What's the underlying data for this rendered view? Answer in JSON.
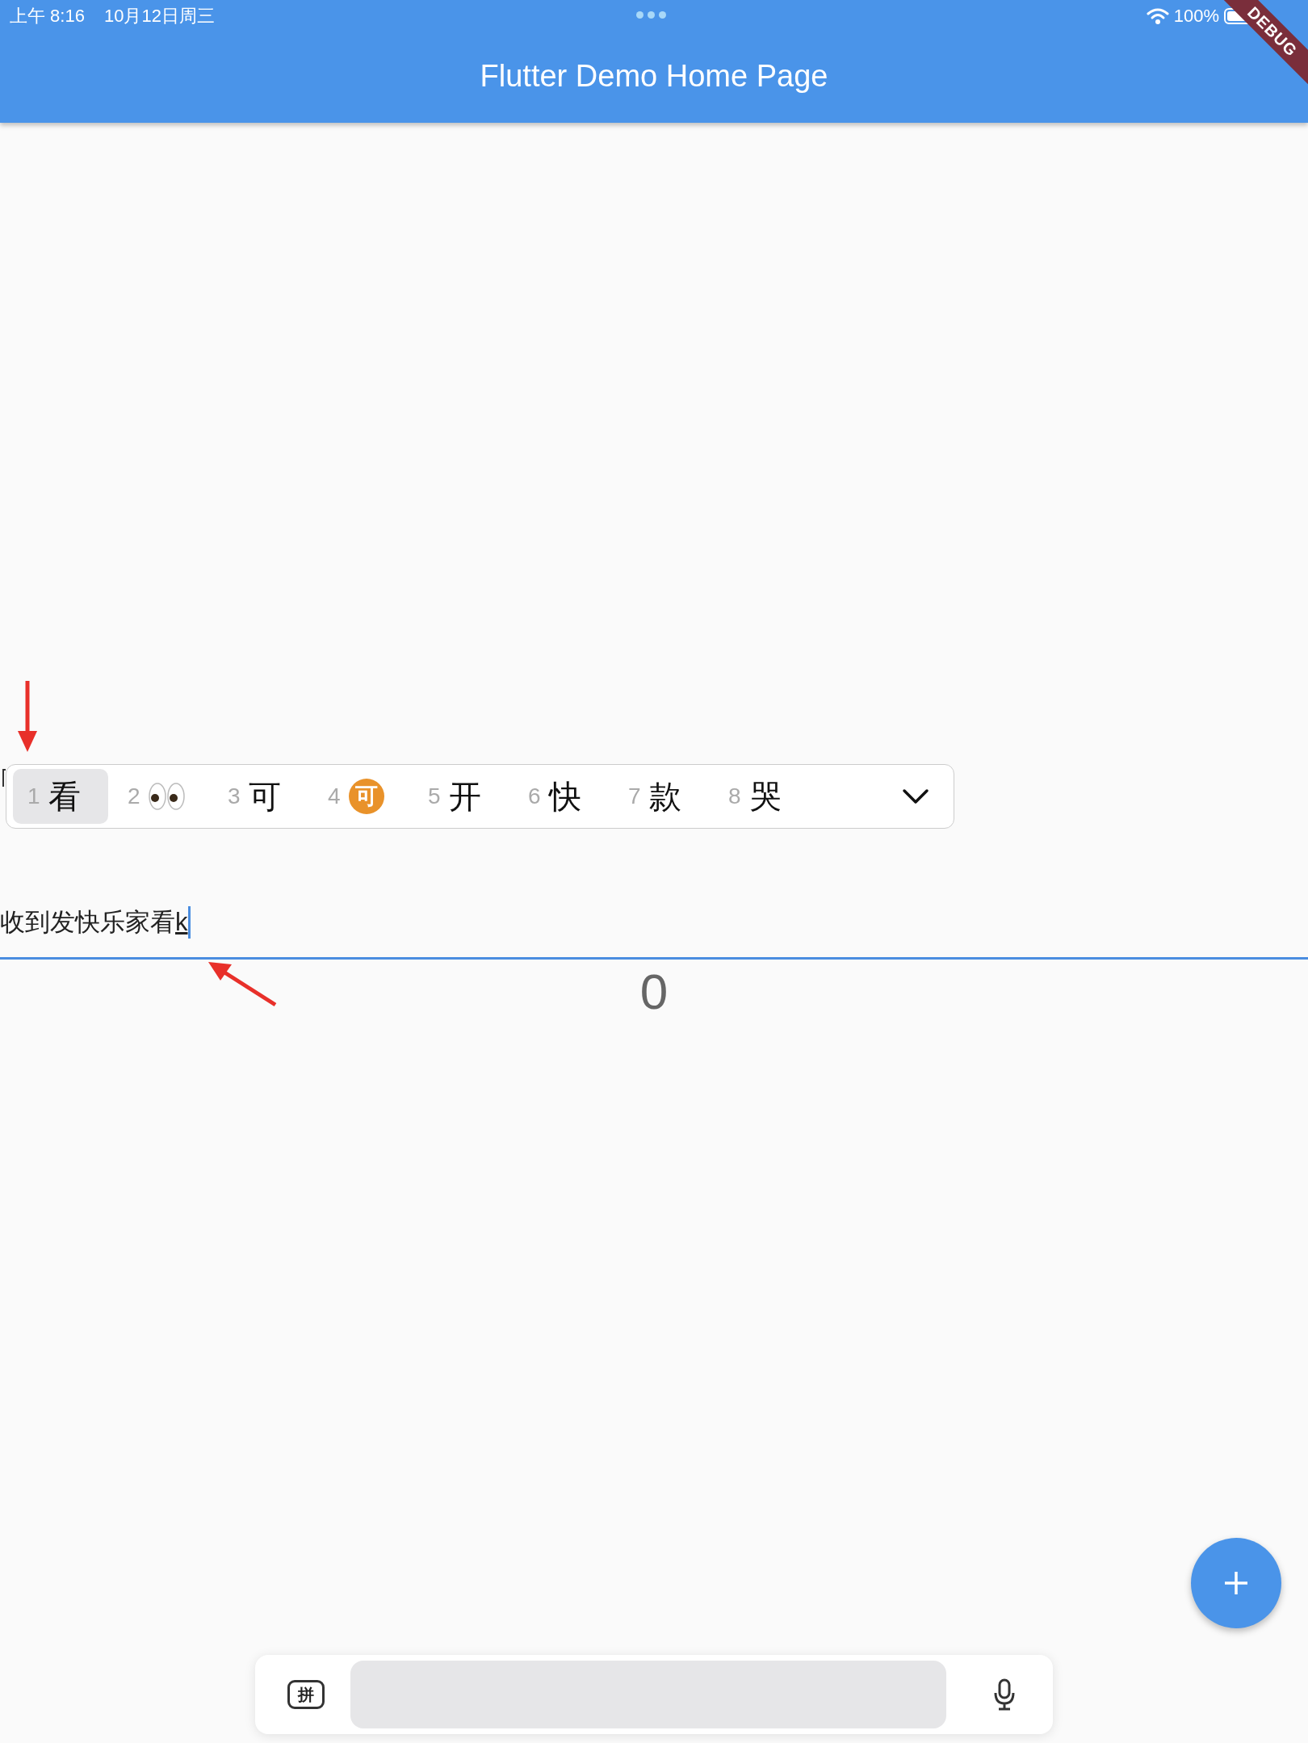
{
  "status_bar": {
    "time": "上午 8:16",
    "date": "10月12日周三",
    "battery": "100%"
  },
  "app_bar": {
    "title": "Flutter Demo Home Page"
  },
  "debug_banner": {
    "label": "DEBUG"
  },
  "candidates": [
    {
      "index": "1",
      "kind": "text",
      "text": "看",
      "selected": true
    },
    {
      "index": "2",
      "kind": "eyes",
      "selected": false
    },
    {
      "index": "3",
      "kind": "text",
      "text": "可",
      "selected": false
    },
    {
      "index": "4",
      "kind": "badge",
      "text": "可",
      "selected": false
    },
    {
      "index": "5",
      "kind": "text",
      "text": "开",
      "selected": false
    },
    {
      "index": "6",
      "kind": "text",
      "text": "快",
      "selected": false
    },
    {
      "index": "7",
      "kind": "text",
      "text": "款",
      "selected": false
    },
    {
      "index": "8",
      "kind": "text",
      "text": "哭",
      "selected": false
    }
  ],
  "text_field": {
    "value": "收到发快乐家看",
    "composing": "k"
  },
  "counter": "0",
  "keyboard_bar": {
    "mode_key": "拼"
  }
}
